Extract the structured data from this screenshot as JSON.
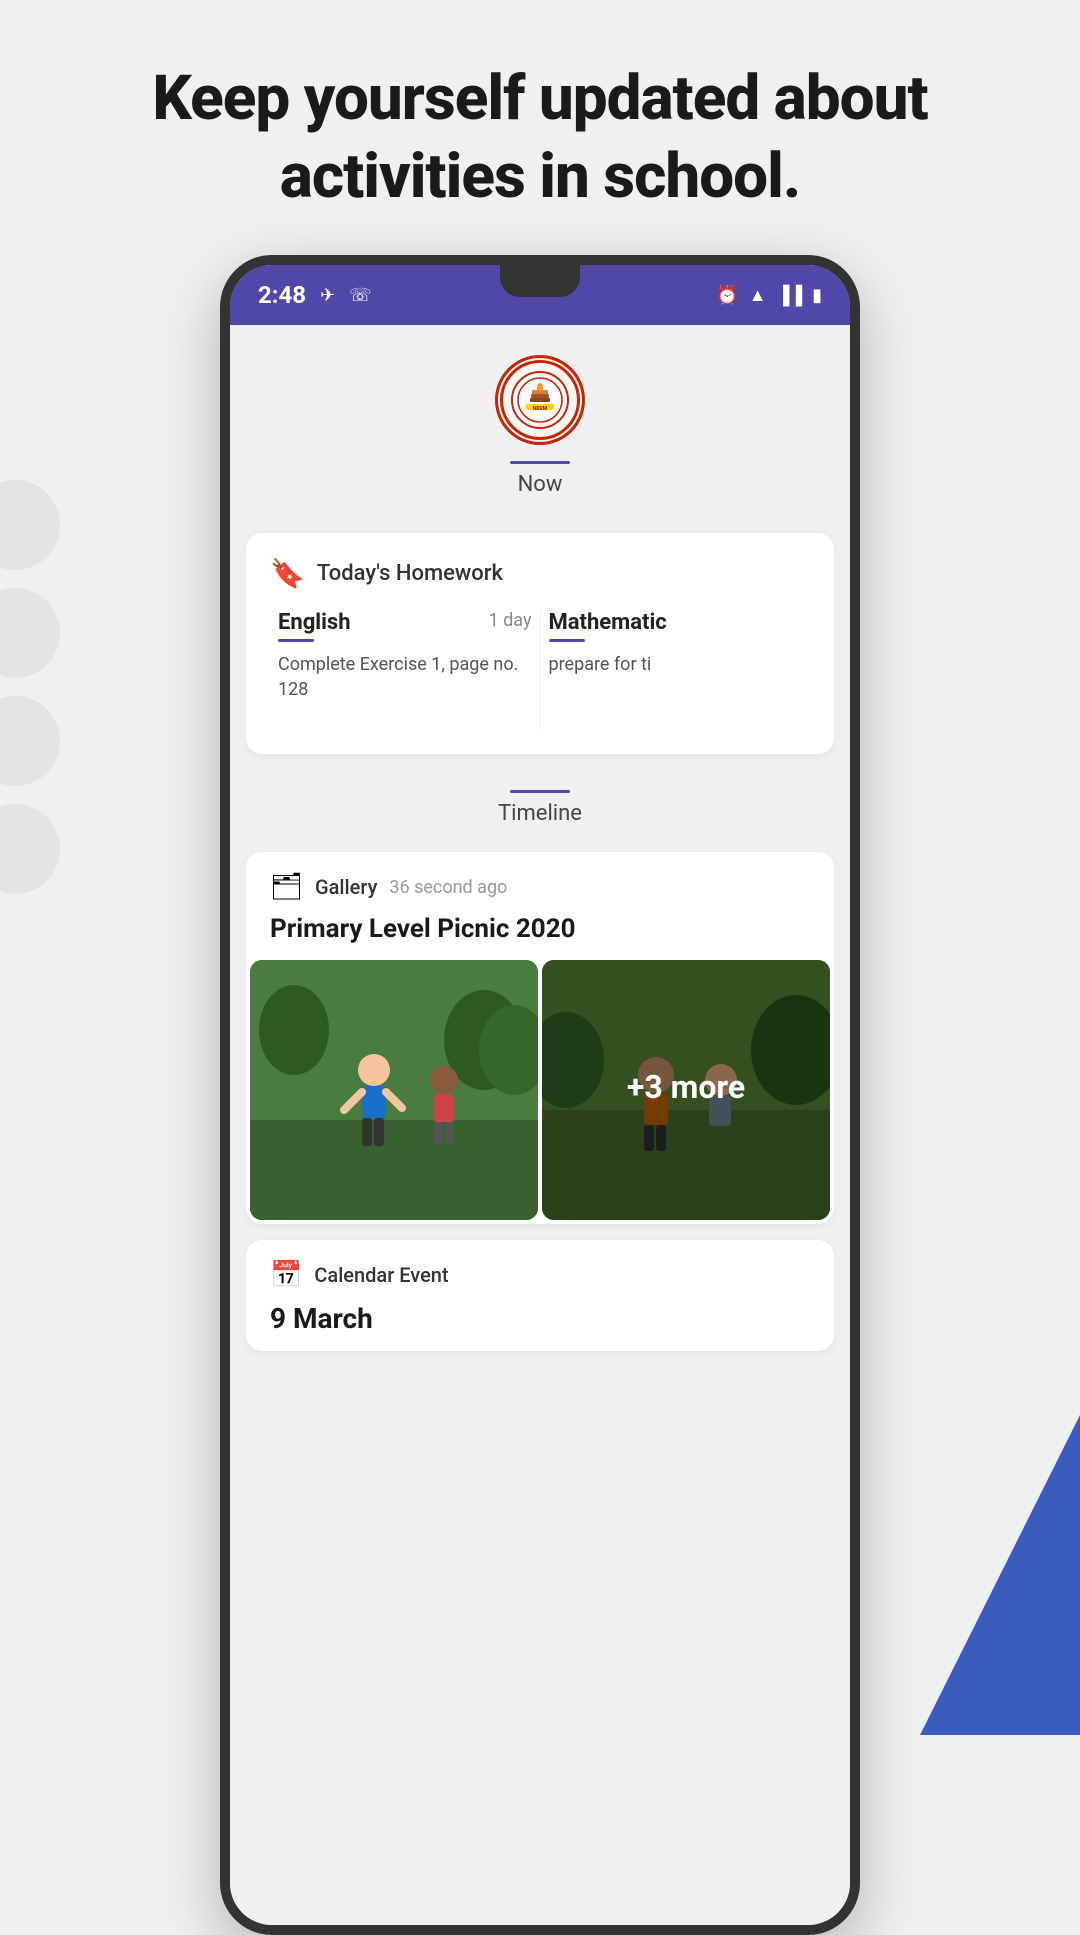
{
  "page": {
    "header": "Keep yourself updated about activities in school.",
    "background_circles": 4
  },
  "status_bar": {
    "time": "2:48",
    "icons_left": [
      "chat-icon",
      "whatsapp-icon"
    ],
    "icons_right": [
      "alarm-icon",
      "wifi-icon",
      "signal-icon",
      "battery-icon"
    ]
  },
  "school": {
    "logo_text": "NDVM",
    "tab_now_label": "Now"
  },
  "homework": {
    "section_title": "Today's Homework",
    "items": [
      {
        "subject": "English",
        "days": "1 day",
        "description": "Complete Exercise 1, page no. 128"
      },
      {
        "subject": "Mathematic",
        "days": "",
        "description": "prepare for ti"
      }
    ]
  },
  "timeline": {
    "label": "Timeline",
    "gallery_item": {
      "type": "Gallery",
      "time_ago": "36 second ago",
      "title": "Primary Level Picnic 2020",
      "more_count": "+3 more"
    },
    "calendar_item": {
      "type": "Calendar Event",
      "date": "9 March"
    }
  }
}
